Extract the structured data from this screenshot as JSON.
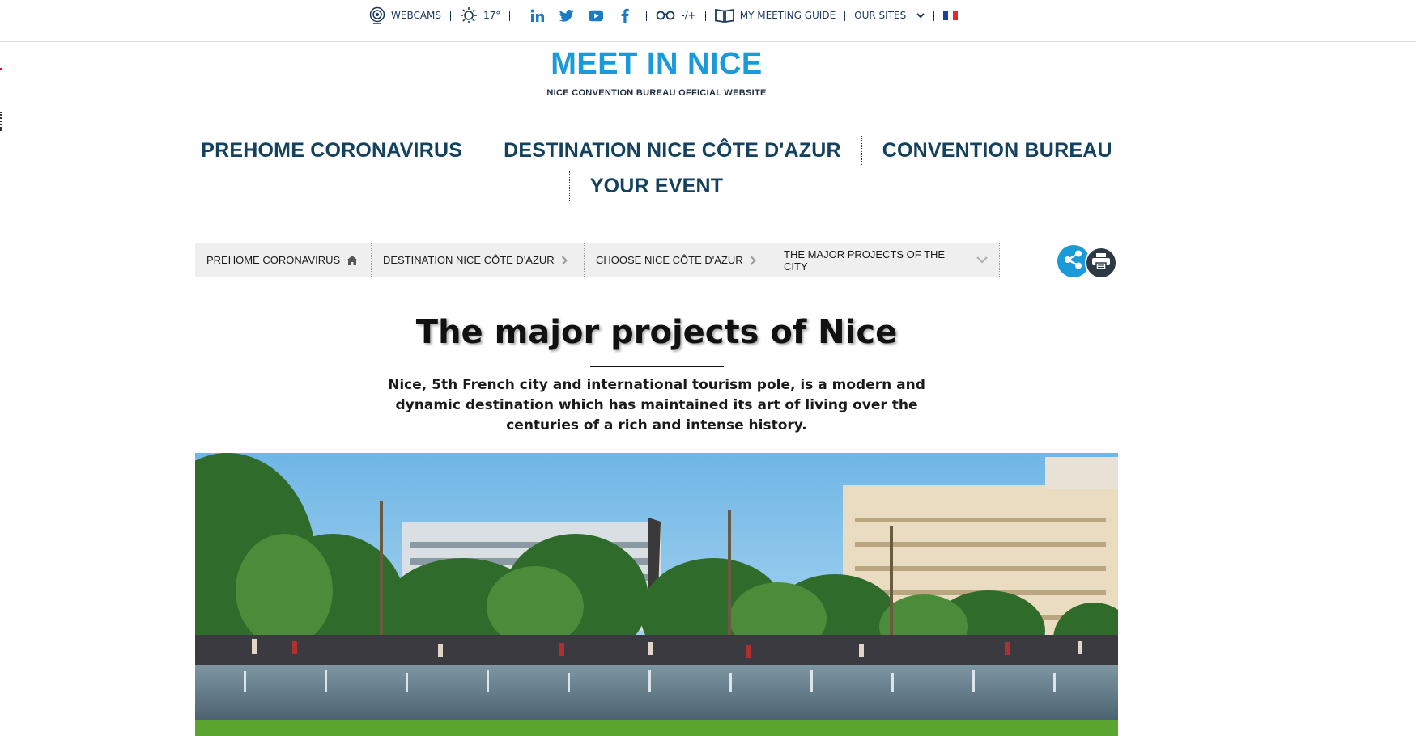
{
  "topbar": {
    "webcams": "WEBCAMS",
    "temperature": "17°",
    "accessibility": "-/+",
    "meeting_guide": "MY MEETING GUIDE",
    "our_sites": "OUR SITES",
    "social_icons": [
      "linkedin-icon",
      "twitter-icon",
      "youtube-icon",
      "facebook-icon"
    ],
    "language_flag": "french-flag-icon"
  },
  "logo": {
    "title": "MEET IN NICE",
    "subtitle": "NICE CONVENTION BUREAU OFFICIAL WEBSITE"
  },
  "nav": {
    "items": [
      "PREHOME CORONAVIRUS",
      "DESTINATION NICE CÔTE D'AZUR",
      "CONVENTION BUREAU",
      "YOUR EVENT"
    ]
  },
  "breadcrumb": {
    "items": [
      {
        "label": "PREHOME CORONAVIRUS",
        "icon": "home-icon"
      },
      {
        "label": "DESTINATION NICE CÔTE D'AZUR",
        "icon": "chevron-right-icon"
      },
      {
        "label": "CHOOSE NICE CÔTE D'AZUR",
        "icon": "chevron-right-icon"
      },
      {
        "label": "THE MAJOR PROJECTS OF THE CITY",
        "icon": "chevron-down-icon"
      }
    ]
  },
  "actions": {
    "share_icon": "share-icon",
    "print_icon": "print-icon"
  },
  "main": {
    "title": "The major projects of Nice",
    "intro": "Nice, 5th French city and international tourism pole, is a modern and dynamic destination which has maintained its art of living over the centuries of a rich and intense history."
  },
  "colors": {
    "brand_blue": "#1a9ad8",
    "nav_navy": "#13415e",
    "share_blue": "#1a9ad8",
    "print_dark": "#2d3a46"
  }
}
